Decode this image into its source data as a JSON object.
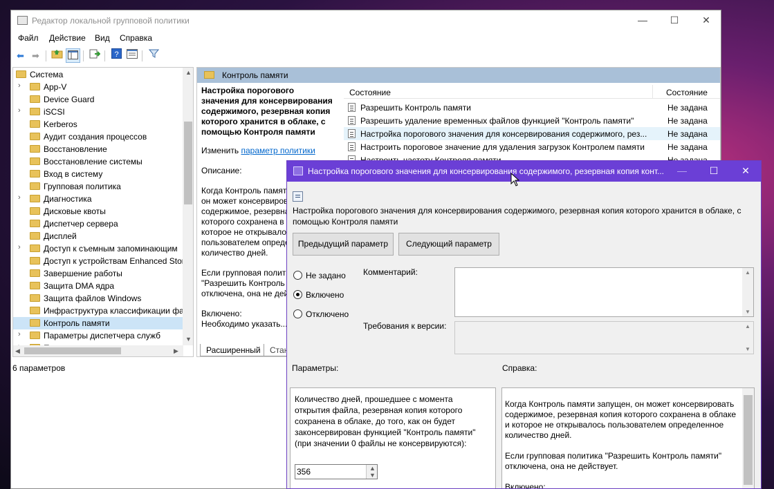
{
  "main_window": {
    "title": "Редактор локальной групповой политики",
    "caption_min": "—",
    "caption_max": "☐",
    "caption_close": "✕",
    "menu": [
      "Файл",
      "Действие",
      "Вид",
      "Справка"
    ],
    "toolbar_icons": [
      "back-arrow-icon",
      "forward-arrow-icon",
      "up-folder-icon",
      "show-hide-tree-icon",
      "export-list-icon",
      "help-icon",
      "properties-icon",
      "filter-icon"
    ],
    "tree": [
      {
        "label": "Система",
        "expander": "▾",
        "level": 0
      },
      {
        "label": "App-V",
        "expander": "›",
        "level": 1
      },
      {
        "label": "Device Guard",
        "expander": "",
        "level": 1
      },
      {
        "label": "iSCSI",
        "expander": "›",
        "level": 1
      },
      {
        "label": "Kerberos",
        "expander": "",
        "level": 1
      },
      {
        "label": "Аудит создания процессов",
        "expander": "",
        "level": 1
      },
      {
        "label": "Восстановление",
        "expander": "",
        "level": 1
      },
      {
        "label": "Восстановление системы",
        "expander": "",
        "level": 1
      },
      {
        "label": "Вход в систему",
        "expander": "",
        "level": 1
      },
      {
        "label": "Групповая политика",
        "expander": "",
        "level": 1
      },
      {
        "label": "Диагностика",
        "expander": "›",
        "level": 1
      },
      {
        "label": "Дисковые квоты",
        "expander": "",
        "level": 1
      },
      {
        "label": "Диспетчер сервера",
        "expander": "",
        "level": 1
      },
      {
        "label": "Дисплей",
        "expander": "",
        "level": 1
      },
      {
        "label": "Доступ к съемным запоминающим",
        "expander": "›",
        "level": 1
      },
      {
        "label": "Доступ к устройствам Enhanced Stor",
        "expander": "",
        "level": 1
      },
      {
        "label": "Завершение работы",
        "expander": "",
        "level": 1
      },
      {
        "label": "Защита DMA ядра",
        "expander": "",
        "level": 1
      },
      {
        "label": "Защита файлов Windows",
        "expander": "",
        "level": 1
      },
      {
        "label": "Инфраструктура классификации фа",
        "expander": "",
        "level": 1
      },
      {
        "label": "Контроль памяти",
        "expander": "",
        "level": 1,
        "selected": true
      },
      {
        "label": "Параметры диспетчера служб",
        "expander": "›",
        "level": 1
      },
      {
        "label": "Параметры ...",
        "expander": "›",
        "level": 1
      }
    ],
    "right_header": "Контроль памяти",
    "description": {
      "heading": "Настройка порогового значения для консервирования содержимого, резервная копия которого хранится в облаке, с помощью Контроля памяти",
      "edit_prefix": "Изменить ",
      "edit_link": "параметр политики",
      "desc_label": "Описание:",
      "para1": "Когда Контроль памяти запущен, он может консервировать содержимое, резервная копия которого сохранена в облаке и которое не открывалось пользователем определенное количество дней.",
      "para2": "Если групповая политика \"Разрешить Контроль памяти\" отключена, она не действует.",
      "para3": "Включено:",
      "para4": "Необходимо указать..."
    },
    "list_header": {
      "name": "Состояние",
      "state": "Состояние"
    },
    "settings": [
      {
        "name": "Разрешить Контроль памяти",
        "state": "Не задана"
      },
      {
        "name": "Разрешить удаление временных файлов функцией \"Контроль памяти\"",
        "state": "Не задана"
      },
      {
        "name": "Настройка порогового значения для консервирования содержимого, рез...",
        "state": "Не задана",
        "highlight": true
      },
      {
        "name": "Настроить пороговое значение для удаления загрузок Контролем памяти",
        "state": "Не задана"
      },
      {
        "name": "Настроить частоту Контроля памяти",
        "state": "Не задана"
      }
    ],
    "tabs": [
      "Расширенный",
      "Стандартный"
    ],
    "status": "6 параметров"
  },
  "dialog": {
    "title": "Настройка порогового значения для консервирования содержимого, резервная копия конт...",
    "policy_text": "Настройка порогового значения для консервирования содержимого, резервная копия которого хранится в облаке, с помощью Контроля памяти",
    "prev_button": "Предыдущий параметр",
    "next_button": "Следующий параметр",
    "radio_not_set": "Не задано",
    "radio_enabled": "Включено",
    "radio_disabled": "Отключено",
    "selected_option": "Включено",
    "comment_label": "Комментарий:",
    "version_label": "Требования к версии:",
    "params_label": "Параметры:",
    "help_label": "Справка:",
    "params_text": "Количество дней, прошедшее с момента открытия файла, резервная копия которого сохранена в облаке, до того, как он будет законсервирован функцией \"Контроль памяти\" (при значении 0 файлы не консервируются):",
    "days_value": "356",
    "help_text": "Когда Контроль памяти запущен, он может консервировать содержимое, резервная копия которого сохранена в облаке и которое не открывалось пользователем определенное количество дней.\n\nЕсли групповая политика \"Разрешить Контроль памяти\" отключена, она не действует.\n\nВключено:"
  }
}
